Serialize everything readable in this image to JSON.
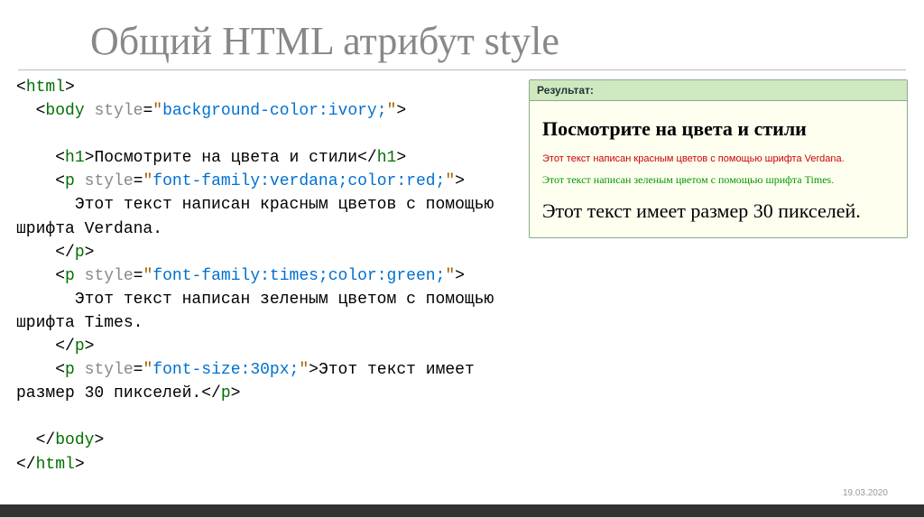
{
  "title": "Общий HTML атрибут style",
  "code": {
    "tag_html": "html",
    "tag_body": "body",
    "attr_style": "style",
    "body_style_val": "background-color:ivory;",
    "tag_h1": "h1",
    "h1_text": "Посмотрите на цвета и стили",
    "tag_p": "p",
    "p1_style_val": "font-family:verdana;color:red;",
    "p1_text": "      Этот текст написан красным цветов с помощью\nшрифта Verdana.",
    "p2_style_val": "font-family:times;color:green;",
    "p2_text": "      Этот текст написан зеленым цветом с помощью\nшрифта Times.",
    "p3_style_val": "font-size:30px;",
    "p3_text": "Этот текст имеет\nразмер 30 пикселей."
  },
  "result": {
    "header": "Результат:",
    "h1": "Посмотрите на цвета и стили",
    "red": "Этот текст написан красным цветов с помощью шрифта Verdana.",
    "green": "Этот текст написан зеленым цветом с помощью шрифта Times.",
    "big": "Этот текст имеет размер 30 пикселей."
  },
  "date": "19.03.2020"
}
